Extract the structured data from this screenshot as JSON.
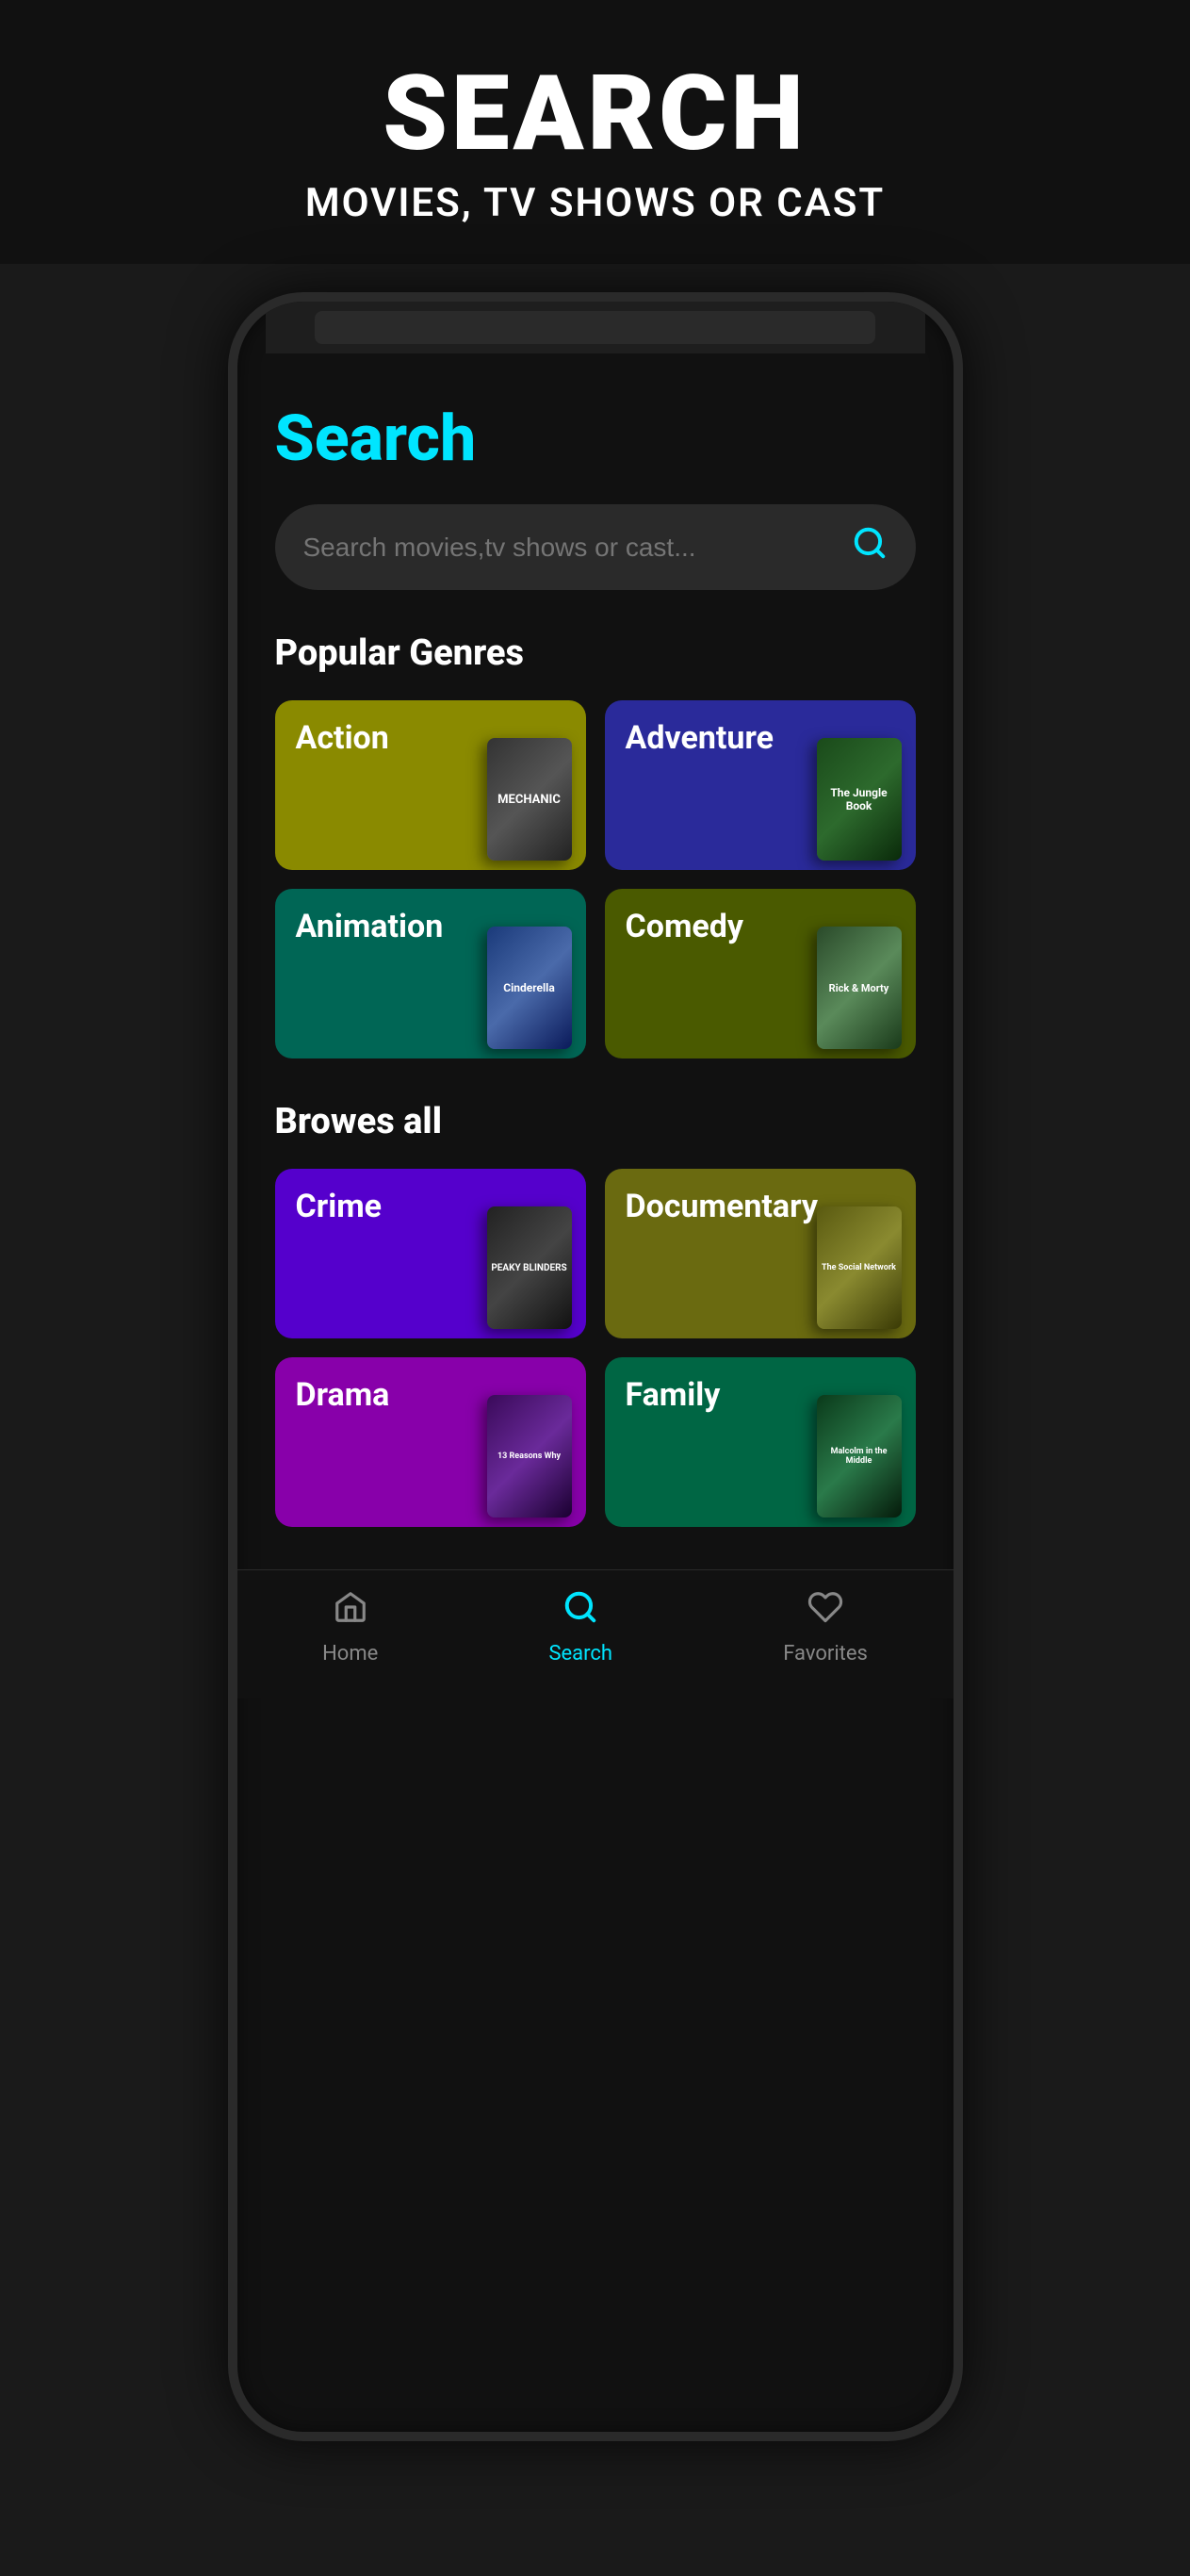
{
  "header": {
    "title": "SEARCH",
    "subtitle": "MOVIES, TV SHOWS OR CAST"
  },
  "app": {
    "search_page_title": "Search",
    "search_placeholder": "Search movies,tv shows or cast...",
    "popular_genres_title": "Popular Genres",
    "browse_all_title": "Browes all",
    "genres_popular": [
      {
        "id": "action",
        "label": "Action",
        "color": "#7a7a00",
        "css_class": "genre-action",
        "poster_text": "MECHANIC"
      },
      {
        "id": "adventure",
        "label": "Adventure",
        "color": "#2a2a9a",
        "css_class": "genre-adventure",
        "poster_text": "The Jungle Book"
      },
      {
        "id": "animation",
        "label": "Animation",
        "color": "#006655",
        "css_class": "genre-animation",
        "poster_text": "Cinderella"
      },
      {
        "id": "comedy",
        "label": "Comedy",
        "color": "#4a5a00",
        "css_class": "genre-comedy",
        "poster_text": "Rick and Morty"
      }
    ],
    "genres_all": [
      {
        "id": "crime",
        "label": "Crime",
        "color": "#5500cc",
        "css_class": "genre-crime",
        "poster_text": "Peaky Blinders"
      },
      {
        "id": "documentary",
        "label": "Documentary",
        "color": "#6a6a10",
        "css_class": "genre-documentary",
        "poster_text": "The Social Network"
      },
      {
        "id": "drama",
        "label": "Drama",
        "color": "#8800aa",
        "css_class": "genre-drama",
        "poster_text": "13 Reasons Why"
      },
      {
        "id": "family",
        "label": "Family",
        "color": "#006644",
        "css_class": "genre-family",
        "poster_text": "Malcolm in the Middle"
      }
    ]
  },
  "bottom_nav": {
    "items": [
      {
        "id": "home",
        "label": "Home",
        "active": false
      },
      {
        "id": "search",
        "label": "Search",
        "active": true
      },
      {
        "id": "favorites",
        "label": "Favorites",
        "active": false
      }
    ]
  }
}
